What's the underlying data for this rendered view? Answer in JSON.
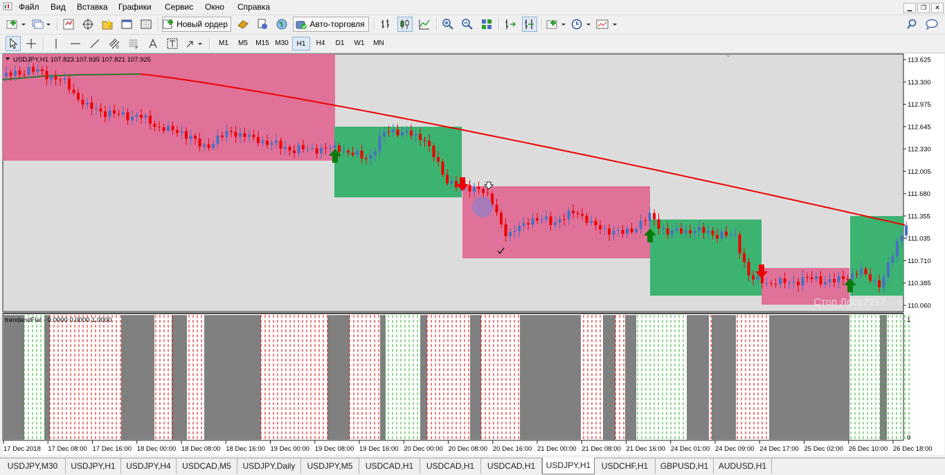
{
  "menu": [
    "Файл",
    "Вид",
    "Вставка",
    "Графики",
    "Сервис",
    "Окно",
    "Справка"
  ],
  "toolbar": {
    "new_order_label": "Новый ордер",
    "autotrading_label": "Авто-торговля",
    "timeframes": [
      "M1",
      "M5",
      "M15",
      "M30",
      "H1",
      "H4",
      "D1",
      "W1",
      "MN"
    ],
    "active_timeframe": "H1"
  },
  "chart": {
    "header": "USDJPY,H1  107.823 107.935 107.821 107.925",
    "indicator_header": "trendandFlat -  0.0000 0.0000 1.0000",
    "watermark": "Стоп Лосс7217",
    "watermark_suffix": "п",
    "indicator_scale": [
      "1",
      "0"
    ],
    "price_labels": [
      "113.625",
      "113.300",
      "112.975",
      "112.645",
      "112.330",
      "112.005",
      "111.680",
      "111.355",
      "111.035",
      "110.710",
      "110.385",
      "110.060"
    ],
    "time_labels": [
      "17 Dec 2018",
      "17 Dec 08:00",
      "17 Dec 16:00",
      "18 Dec 00:00",
      "18 Dec 08:00",
      "18 Dec 16:00",
      "19 Dec 00:00",
      "19 Dec 08:00",
      "19 Dec 16:00",
      "20 Dec 00:00",
      "20 Dec 08:00",
      "20 Dec 16:00",
      "21 Dec 00:00",
      "21 Dec 08:00",
      "21 Dec 16:00",
      "24 Dec 01:00",
      "24 Dec 09:00",
      "24 Dec 17:00",
      "25 Dec 02:00",
      "26 Dec 10:00",
      "26 Dec 18:00"
    ],
    "colors": {
      "bull_candle": "#4a6fc4",
      "bear_candle": "#ee0000",
      "pink_zone": "#e07198",
      "green_zone": "#3cb371",
      "ma_line": "#ee0000",
      "chart_background": "#dcdcdc"
    }
  },
  "tabs": [
    "USDJPY,M30",
    "USDJPY,H1",
    "USDJPY,H4",
    "USDCAD,M5",
    "USDJPY,Daily",
    "USDJPY,M5",
    "USDCAD,H1",
    "USDCAD,H1",
    "USDCAD,H1",
    "USDJPY,H1",
    "USDCHF,H1",
    "GBPUSD,H1",
    "AUDUSD,H1"
  ],
  "active_tab": "USDJPY,H1"
}
